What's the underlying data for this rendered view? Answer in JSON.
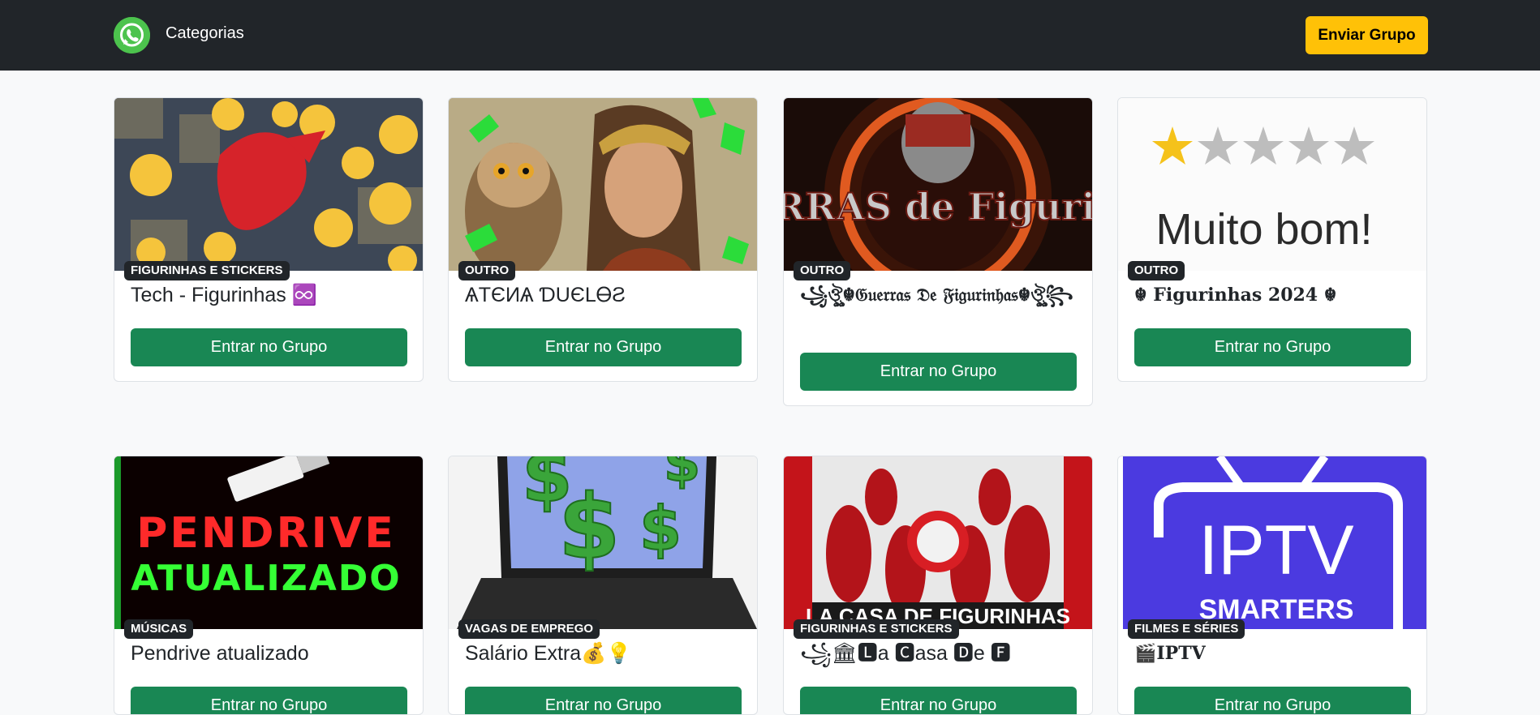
{
  "navbar": {
    "logo_icon": "whatsapp-icon",
    "categories_label": "Categorias",
    "send_button_label": "Enviar Grupo",
    "colors": {
      "background": "#212529",
      "accent": "#ffc107",
      "logo": "#4cc34d"
    }
  },
  "cards": [
    {
      "category": "FIGURINHAS E STICKERS",
      "title": "Tech - Figurinhas ♾️",
      "button_label": "Entrar no Grupo"
    },
    {
      "category": "OUTRO",
      "title": "ѦТЄИѦ ƊUЄLᎾƧ",
      "button_label": "Entrar no Grupo"
    },
    {
      "category": "OUTRO",
      "title": "꧁ঔৣ☬𝔊𝔲𝔢𝔯𝔯𝔞𝔰 𝔇𝔢 𝔉𝔦𝔤𝔲𝔯𝔦𝔫𝔥𝔞𝔰☬ঔৣ꧂",
      "button_label": "Entrar no Grupo",
      "image_text": "GUERRAS de Figurinhas"
    },
    {
      "category": "OUTRO",
      "title": "☬ 𝐅𝐢𝐠𝐮𝐫𝐢𝐧𝐡𝐚𝐬 𝟐𝟎𝟐𝟒 ☬",
      "button_label": "Entrar no Grupo",
      "image_text": "Muito bom!"
    },
    {
      "category": "MÚSICAS",
      "title": "Pendrive atualizado",
      "button_label": "Entrar no Grupo",
      "image_text_1": "PENDRIVE",
      "image_text_2": "ATUALIZADO"
    },
    {
      "category": "VAGAS DE EMPREGO",
      "title": "Salário Extra💰💡",
      "button_label": "Entrar no Grupo"
    },
    {
      "category": "FIGURINHAS E STICKERS",
      "title": "꧁🏛🅻a 🅲asa 🅳e 🅵",
      "button_label": "Entrar no Grupo",
      "image_text": "LA CASA DE FIGURINHAS"
    },
    {
      "category": "FILMES E SÉRIES",
      "title": "🎬𝐈𝐏𝐓𝐕",
      "button_label": "Entrar no Grupo",
      "image_text_1": "IPTV",
      "image_text_2": "SMARTERS"
    }
  ],
  "colors": {
    "join_button": "#198754",
    "badge": "#212529",
    "page_bg": "#f8f9fa"
  }
}
